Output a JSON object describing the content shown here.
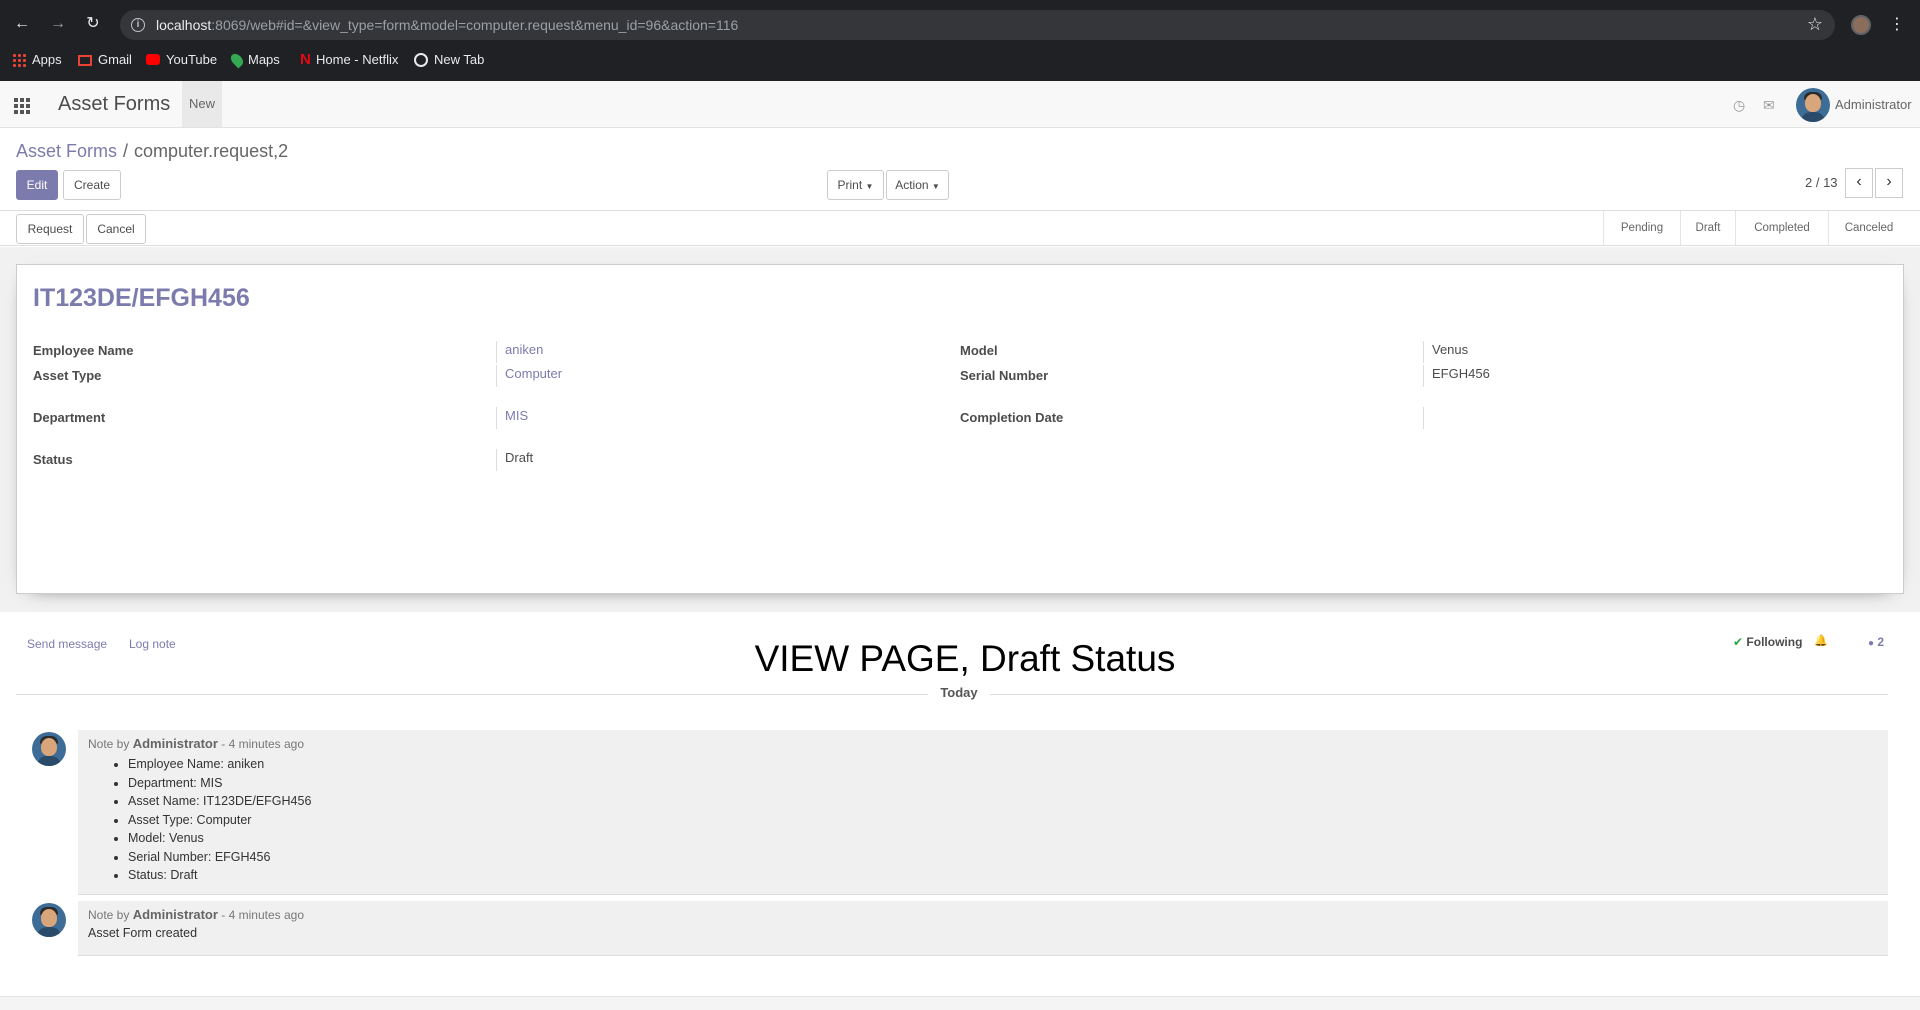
{
  "browser": {
    "url_host": "localhost",
    "url_rest": ":8069/web#id=&view_type=form&model=computer.request&menu_id=96&action=116",
    "bookmarks": [
      "Apps",
      "Gmail",
      "YouTube",
      "Maps",
      "Home - Netflix",
      "New Tab"
    ]
  },
  "navbar": {
    "app_name": "Asset Forms",
    "menu_new": "New",
    "user_name": "Administrator"
  },
  "breadcrumb": {
    "parent": "Asset Forms",
    "separator": "/",
    "current": "computer.request,2"
  },
  "buttons": {
    "edit": "Edit",
    "create": "Create",
    "print": "Print",
    "action": "Action",
    "request": "Request",
    "cancel": "Cancel"
  },
  "pager": {
    "value": "2 / 13"
  },
  "statusbar": {
    "stages": [
      "Pending",
      "Draft",
      "Completed",
      "Canceled"
    ],
    "active": "Draft"
  },
  "record": {
    "title": "IT123DE/EFGH456",
    "fields": {
      "employee_name": {
        "label": "Employee Name",
        "value": "aniken"
      },
      "asset_type": {
        "label": "Asset Type",
        "value": "Computer"
      },
      "department": {
        "label": "Department",
        "value": "MIS"
      },
      "status": {
        "label": "Status",
        "value": "Draft"
      },
      "model": {
        "label": "Model",
        "value": "Venus"
      },
      "serial_number": {
        "label": "Serial Number",
        "value": "EFGH456"
      },
      "completion_date": {
        "label": "Completion Date",
        "value": ""
      }
    }
  },
  "chatter": {
    "send_message": "Send message",
    "log_note": "Log note",
    "banner": "VIEW PAGE, Draft Status",
    "following": "Following",
    "followers_count": "2",
    "date_separator": "Today",
    "messages": [
      {
        "prefix": "Note by",
        "author": "Administrator",
        "time": "- 4 minutes ago",
        "items": [
          "Employee Name: aniken",
          "Department: MIS",
          "Asset Name: IT123DE/EFGH456",
          "Asset Type: Computer",
          "Model: Venus",
          "Serial Number: EFGH456",
          "Status: Draft"
        ]
      },
      {
        "prefix": "Note by",
        "author": "Administrator",
        "time": "- 4 minutes ago",
        "body": "Asset Form created"
      }
    ]
  },
  "colors": {
    "brand": "#7c7bad",
    "browser_chrome": "#202124"
  }
}
